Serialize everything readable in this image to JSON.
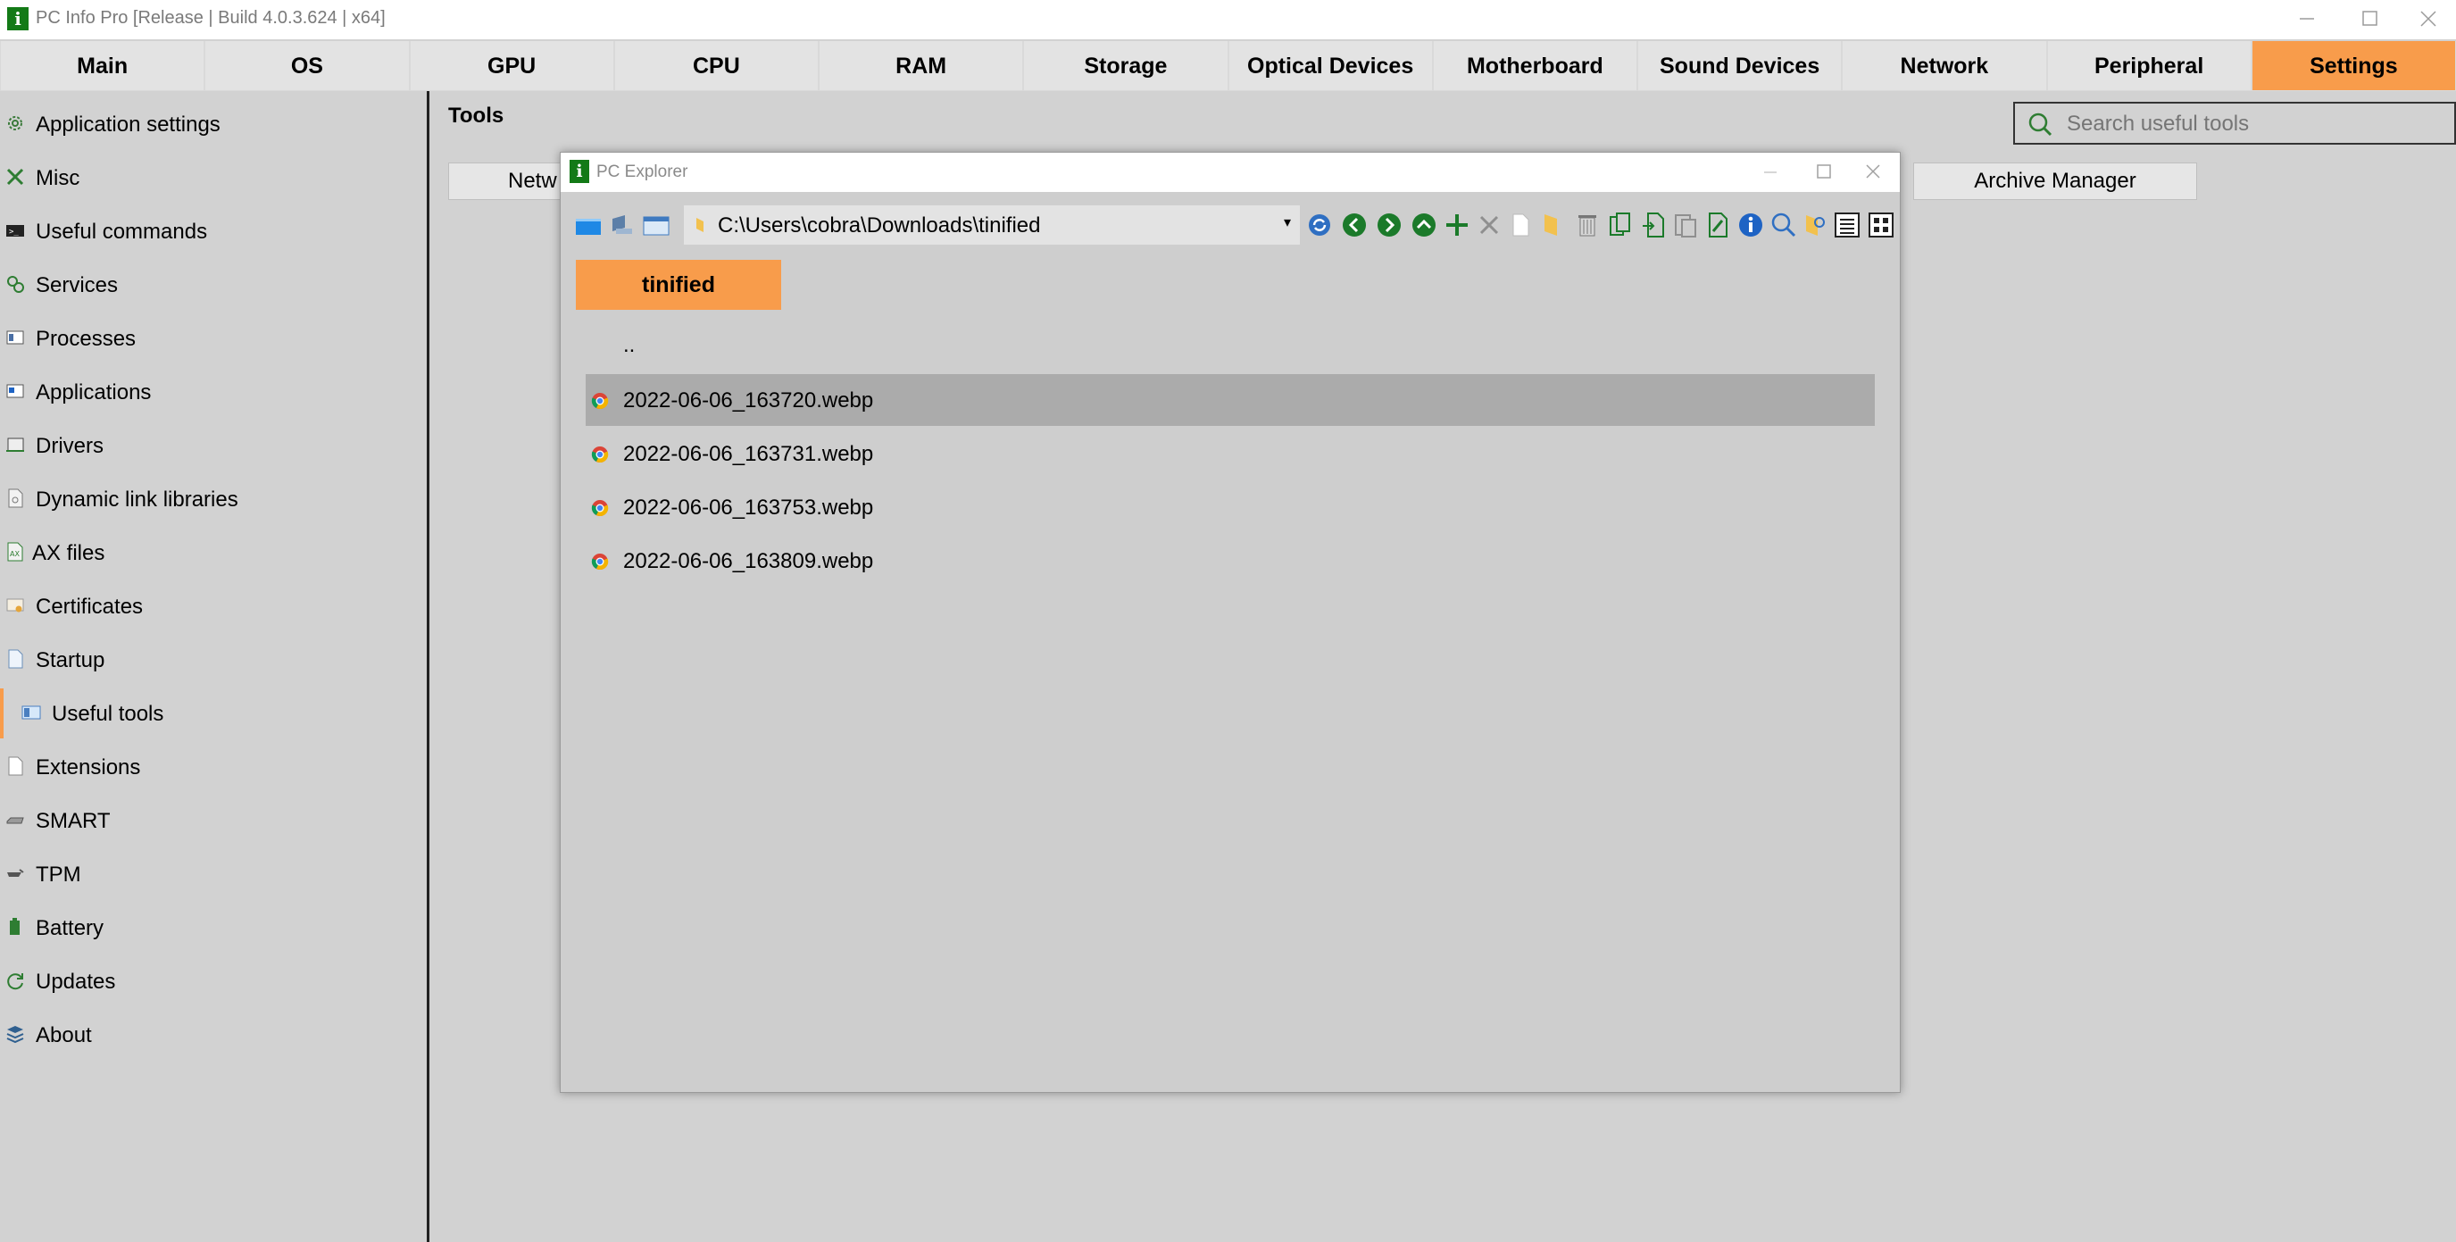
{
  "window": {
    "title": "PC Info Pro [Release | Build 4.0.3.624 | x64]",
    "logo": "i"
  },
  "tabs": [
    {
      "label": "Main"
    },
    {
      "label": "OS"
    },
    {
      "label": "GPU"
    },
    {
      "label": "CPU"
    },
    {
      "label": "RAM"
    },
    {
      "label": "Storage"
    },
    {
      "label": "Optical Devices"
    },
    {
      "label": "Motherboard"
    },
    {
      "label": "Sound Devices"
    },
    {
      "label": "Network"
    },
    {
      "label": "Peripheral"
    },
    {
      "label": "Settings",
      "active": true
    }
  ],
  "sidebar": {
    "items": [
      {
        "label": "Application settings",
        "icon": "gear-icon"
      },
      {
        "label": "Misc",
        "icon": "tools-icon"
      },
      {
        "label": "Useful commands",
        "icon": "terminal-icon"
      },
      {
        "label": "Services",
        "icon": "services-gear-icon"
      },
      {
        "label": "Processes",
        "icon": "process-window-icon"
      },
      {
        "label": "Applications",
        "icon": "application-window-icon"
      },
      {
        "label": "Drivers",
        "icon": "driver-icon"
      },
      {
        "label": "Dynamic link libraries",
        "icon": "dll-file-icon"
      },
      {
        "label": "AX files",
        "icon": "ax-file-icon"
      },
      {
        "label": "Certificates",
        "icon": "certificate-icon"
      },
      {
        "label": "Startup",
        "icon": "startup-icon"
      },
      {
        "label": "Useful tools",
        "icon": "useful-tools-icon",
        "active": true
      },
      {
        "label": "Extensions",
        "icon": "extension-file-icon"
      },
      {
        "label": "SMART",
        "icon": "hard-drive-icon"
      },
      {
        "label": "TPM",
        "icon": "tpm-chip-icon"
      },
      {
        "label": "Battery",
        "icon": "battery-icon"
      },
      {
        "label": "Updates",
        "icon": "refresh-icon"
      },
      {
        "label": "About",
        "icon": "about-icon"
      }
    ]
  },
  "main": {
    "section_title": "Tools",
    "search_placeholder": "Search useful tools",
    "tool_buttons": [
      {
        "label": "Netw"
      },
      {
        "label": "Archive Manager"
      }
    ]
  },
  "explorer": {
    "title": "PC Explorer",
    "logo": "i",
    "path": "C:\\Users\\cobra\\Downloads\\tinified",
    "breadcrumb": "tinified",
    "parent_entry": "..",
    "files": [
      {
        "name": "2022-06-06_163720.webp",
        "selected": true
      },
      {
        "name": "2022-06-06_163731.webp"
      },
      {
        "name": "2022-06-06_163753.webp"
      },
      {
        "name": "2022-06-06_163809.webp"
      }
    ]
  },
  "colors": {
    "accent": "#f89c4b",
    "background": "#d2d2d2",
    "selected_row": "#ababab",
    "logo_green": "#137a17"
  }
}
